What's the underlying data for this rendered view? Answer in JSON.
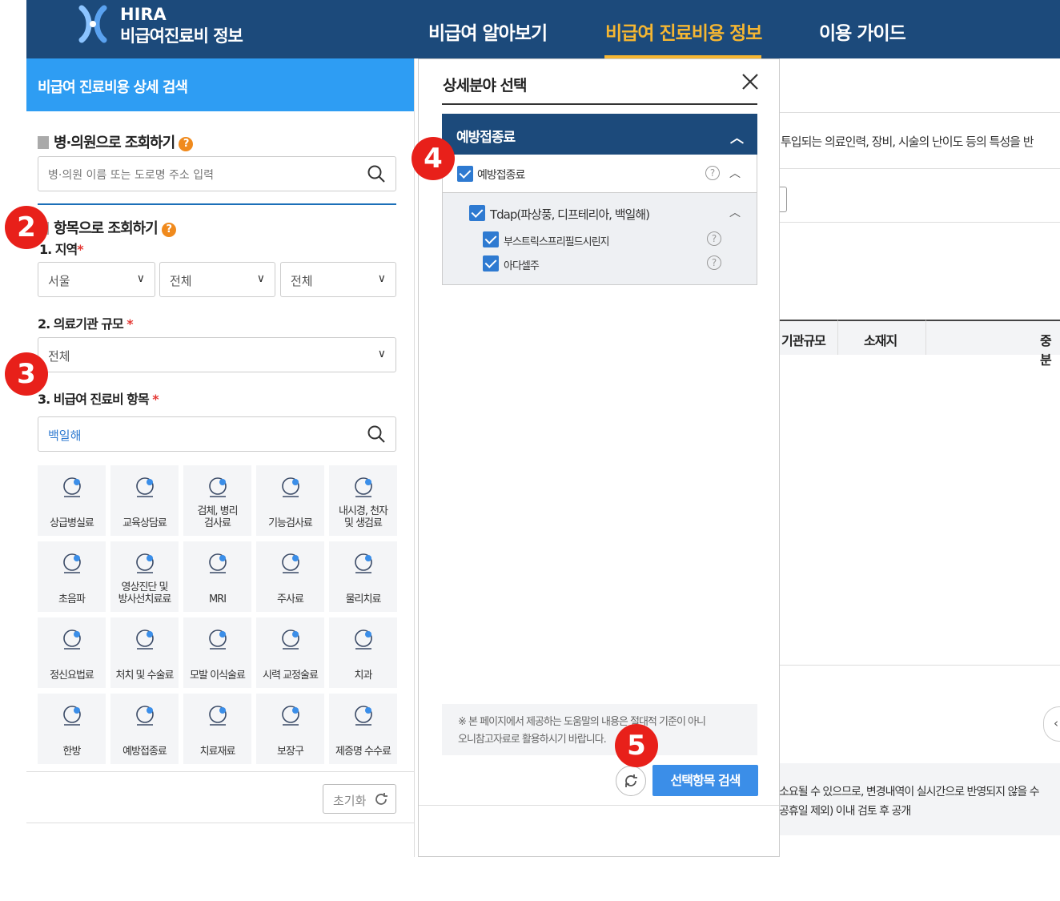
{
  "header": {
    "logo_line1": "HIRA",
    "logo_line2": "비급여진료비 정보",
    "nav": [
      {
        "label": "비급여 알아보기",
        "active": false
      },
      {
        "label": "비급여 진료비용 정보",
        "active": true
      },
      {
        "label": "이용 가이드",
        "active": false
      }
    ]
  },
  "left": {
    "panel_title": "비급여 진료비용 상세 검색",
    "hospital_section": {
      "title": "병·의원으로 조회하기",
      "help": "?",
      "placeholder": "병·의원 이름 또는 도로명 주소 입력"
    },
    "item_section": {
      "title": "항목으로 조회하기",
      "help": "?"
    },
    "region": {
      "label": "1. 지역",
      "required": "*",
      "values": [
        "서울",
        "전체",
        "전체"
      ]
    },
    "scale": {
      "label": "2. 의료기관 규모",
      "required": "*",
      "value": "전체"
    },
    "item": {
      "label": "3. 비급여 진료비 항목",
      "required": "*",
      "value": "백일해"
    },
    "categories": [
      {
        "label": "상급병실료",
        "icon": "bed-icon"
      },
      {
        "label": "교육상담료",
        "icon": "counseling-icon"
      },
      {
        "label": "검체, 병리\n검사료",
        "icon": "pathology-icon"
      },
      {
        "label": "기능검사료",
        "icon": "function-test-icon"
      },
      {
        "label": "내시경, 천자\n및 생검료",
        "icon": "endoscope-icon"
      },
      {
        "label": "초음파",
        "icon": "ultrasound-icon"
      },
      {
        "label": "영상진단 및\n방사선치료료",
        "icon": "imaging-icon"
      },
      {
        "label": "MRI",
        "icon": "mri-icon"
      },
      {
        "label": "주사료",
        "icon": "syringe-icon"
      },
      {
        "label": "물리치료",
        "icon": "physical-therapy-icon"
      },
      {
        "label": "정신요법료",
        "icon": "brain-icon"
      },
      {
        "label": "처치 및 수술료",
        "icon": "surgery-icon"
      },
      {
        "label": "모발 이식술료",
        "icon": "hair-icon"
      },
      {
        "label": "시력 교정술료",
        "icon": "eye-icon"
      },
      {
        "label": "치과",
        "icon": "tooth-icon"
      },
      {
        "label": "한방",
        "icon": "acupuncture-icon"
      },
      {
        "label": "예방접종료",
        "icon": "vaccine-icon"
      },
      {
        "label": "치료재료",
        "icon": "material-icon"
      },
      {
        "label": "보장구",
        "icon": "wheelchair-icon"
      },
      {
        "label": "제증명 수수료",
        "icon": "certificate-icon"
      }
    ],
    "reset_label": "초기화"
  },
  "modal": {
    "title": "상세분야 선택",
    "group_title": "예방접종료",
    "tree": {
      "level1": {
        "label": "예방접종료",
        "checked": true,
        "help": "?"
      },
      "level2": {
        "label": "Tdap(파상풍, 디프테리아, 백일해)",
        "checked": true
      },
      "level3": [
        {
          "label": "부스트릭스프리필드시린지",
          "checked": true,
          "help": "?"
        },
        {
          "label": "아다셀주",
          "checked": true,
          "help": "?"
        }
      ]
    },
    "notice_line1": "※ 본 페이지에서 제공하는 도움말의 내용은 절대적 기준이 아니",
    "notice_line2": "오니참고자료로 활용하시기 바랍니다.",
    "search_label": "선택항목 검색"
  },
  "background": {
    "desc": "투입되는 의료인력, 장비, 시술의 난이도 등의 특성을 반",
    "col1": "기관규모",
    "col2": "소재지",
    "col3": "중분",
    "footer1": "소요될 수 있으므로, 변경내역이 실시간으로 반영되지 않을 수",
    "footer2": "공휴일 제외) 이내 검토 후 공개"
  },
  "annotations": [
    "2",
    "3",
    "4",
    "5"
  ],
  "colors": {
    "primary": "#1c4a7b",
    "accent": "#f5b632",
    "blue": "#2e9df3",
    "badge": "#e8201a"
  }
}
